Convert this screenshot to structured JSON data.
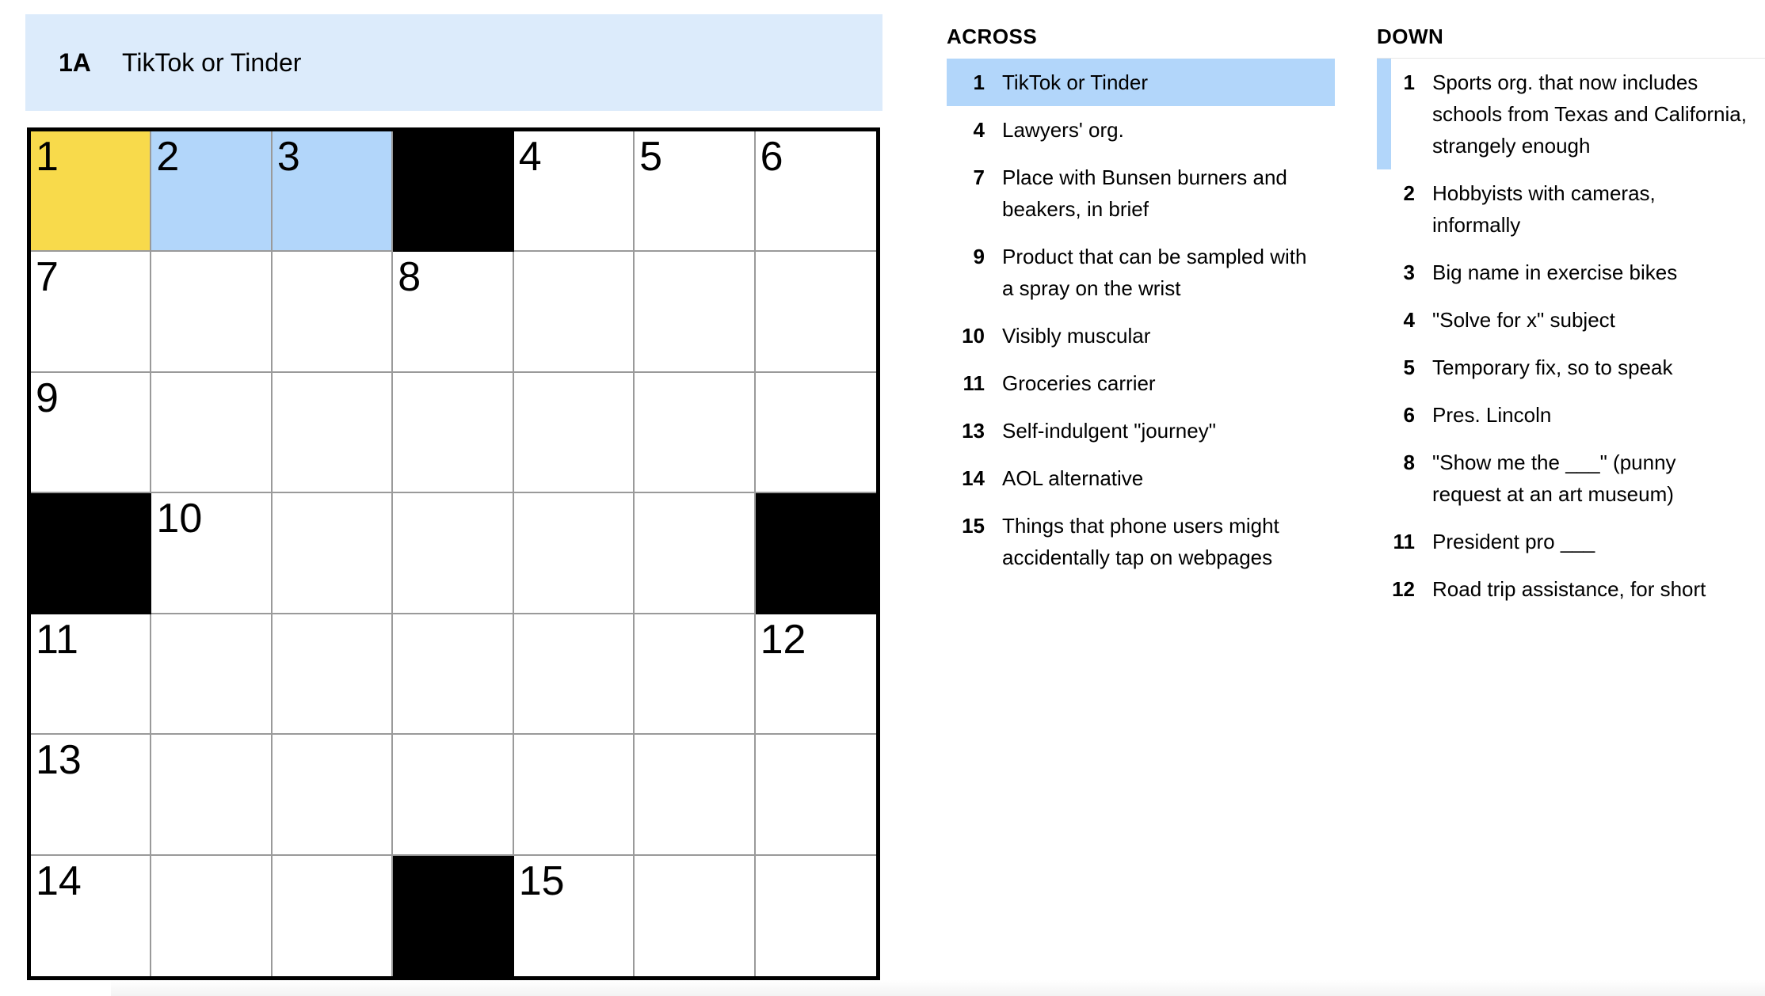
{
  "current_clue": {
    "label": "1A",
    "text": "TikTok or Tinder"
  },
  "grid": {
    "size": 7,
    "cells": [
      [
        {
          "n": "1",
          "s": "selected"
        },
        {
          "n": "2",
          "s": "highlighted"
        },
        {
          "n": "3",
          "s": "highlighted"
        },
        {
          "s": "block"
        },
        {
          "n": "4"
        },
        {
          "n": "5"
        },
        {
          "n": "6"
        }
      ],
      [
        {
          "n": "7"
        },
        {},
        {},
        {
          "n": "8"
        },
        {},
        {},
        {}
      ],
      [
        {
          "n": "9"
        },
        {},
        {},
        {},
        {},
        {},
        {}
      ],
      [
        {
          "s": "block"
        },
        {
          "n": "10"
        },
        {},
        {},
        {},
        {},
        {
          "s": "block"
        }
      ],
      [
        {
          "n": "11"
        },
        {},
        {},
        {},
        {},
        {},
        {
          "n": "12"
        }
      ],
      [
        {
          "n": "13"
        },
        {},
        {},
        {},
        {},
        {},
        {}
      ],
      [
        {
          "n": "14"
        },
        {},
        {},
        {
          "s": "block"
        },
        {
          "n": "15"
        },
        {},
        {}
      ]
    ]
  },
  "across": {
    "title": "ACROSS",
    "clues": [
      {
        "num": "1",
        "text": "TikTok or Tinder",
        "active": true
      },
      {
        "num": "4",
        "text": "Lawyers' org."
      },
      {
        "num": "7",
        "text": "Place with Bunsen burners and beakers, in brief"
      },
      {
        "num": "9",
        "text": "Product that can be sampled with a spray on the wrist"
      },
      {
        "num": "10",
        "text": "Visibly muscular"
      },
      {
        "num": "11",
        "text": "Groceries carrier"
      },
      {
        "num": "13",
        "text": "Self-indulgent \"journey\""
      },
      {
        "num": "14",
        "text": "AOL alternative"
      },
      {
        "num": "15",
        "text": "Things that phone users might accidentally tap on webpages"
      }
    ]
  },
  "down": {
    "title": "DOWN",
    "clues": [
      {
        "num": "1",
        "text": "Sports org. that now includes schools from Texas and California, strangely enough",
        "crossing": true
      },
      {
        "num": "2",
        "text": "Hobbyists with cameras, informally"
      },
      {
        "num": "3",
        "text": "Big name in exercise bikes"
      },
      {
        "num": "4",
        "text": "\"Solve for x\" subject"
      },
      {
        "num": "5",
        "text": "Temporary fix, so to speak"
      },
      {
        "num": "6",
        "text": "Pres. Lincoln"
      },
      {
        "num": "8",
        "text": "\"Show me the ___\" (punny request at an art museum)"
      },
      {
        "num": "11",
        "text": "President pro ___"
      },
      {
        "num": "12",
        "text": "Road trip assistance, for short"
      }
    ]
  },
  "colors": {
    "selected_cell": "#f8da4b",
    "highlighted_cell": "#b2d6fa",
    "clue_bar": "#dcebfb",
    "block": "#000000"
  }
}
